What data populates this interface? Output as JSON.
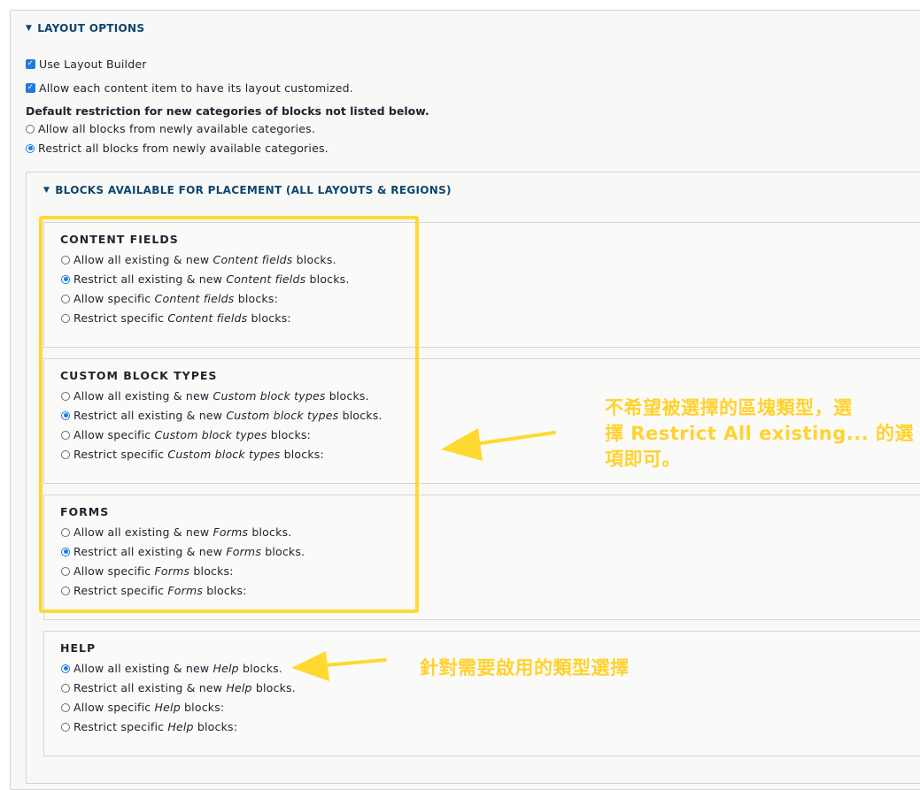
{
  "layout_options": {
    "summary": "LAYOUT OPTIONS",
    "use_layout_builder": {
      "label": "Use Layout Builder",
      "checked": true
    },
    "allow_customize": {
      "label": "Allow each content item to have its layout customized.",
      "checked": true
    },
    "default_restriction": {
      "label": "Default restriction for new categories of blocks not listed below.",
      "options": [
        {
          "label": "Allow all blocks from newly available categories.",
          "selected": false
        },
        {
          "label": "Restrict all blocks from newly available categories.",
          "selected": true
        }
      ]
    }
  },
  "blocks": {
    "summary": "BLOCKS AVAILABLE FOR PLACEMENT (ALL LAYOUTS & REGIONS)",
    "groups": [
      {
        "title": "CONTENT FIELDS",
        "options": [
          {
            "pre": "Allow all existing & new ",
            "em": "Content fields",
            "post": " blocks.",
            "selected": false
          },
          {
            "pre": "Restrict all existing & new ",
            "em": "Content fields",
            "post": " blocks.",
            "selected": true
          },
          {
            "pre": "Allow specific ",
            "em": "Content fields",
            "post": " blocks:",
            "selected": false
          },
          {
            "pre": "Restrict specific ",
            "em": "Content fields",
            "post": " blocks:",
            "selected": false
          }
        ]
      },
      {
        "title": "CUSTOM BLOCK TYPES",
        "options": [
          {
            "pre": "Allow all existing & new ",
            "em": "Custom block types",
            "post": " blocks.",
            "selected": false
          },
          {
            "pre": "Restrict all existing & new ",
            "em": "Custom block types",
            "post": " blocks.",
            "selected": true
          },
          {
            "pre": "Allow specific ",
            "em": "Custom block types",
            "post": " blocks:",
            "selected": false
          },
          {
            "pre": "Restrict specific ",
            "em": "Custom block types",
            "post": " blocks:",
            "selected": false
          }
        ]
      },
      {
        "title": "FORMS",
        "options": [
          {
            "pre": "Allow all existing & new ",
            "em": "Forms",
            "post": " blocks.",
            "selected": false
          },
          {
            "pre": "Restrict all existing & new ",
            "em": "Forms",
            "post": " blocks.",
            "selected": true
          },
          {
            "pre": "Allow specific ",
            "em": "Forms",
            "post": " blocks:",
            "selected": false
          },
          {
            "pre": "Restrict specific ",
            "em": "Forms",
            "post": " blocks:",
            "selected": false
          }
        ]
      },
      {
        "title": "HELP",
        "options": [
          {
            "pre": "Allow all existing & new ",
            "em": "Help",
            "post": " blocks.",
            "selected": true
          },
          {
            "pre": "Restrict all existing & new ",
            "em": "Help",
            "post": " blocks.",
            "selected": false
          },
          {
            "pre": "Allow specific ",
            "em": "Help",
            "post": " blocks:",
            "selected": false
          },
          {
            "pre": "Restrict specific ",
            "em": "Help",
            "post": " blocks:",
            "selected": false
          }
        ]
      }
    ]
  },
  "annotations": {
    "note1": [
      "不希望被選擇的區塊類型，選",
      "擇 Restrict All existing... 的選",
      "項即可。"
    ],
    "note2": "針對需要啟用的類型選擇",
    "highlight_color": "#ffd930"
  }
}
